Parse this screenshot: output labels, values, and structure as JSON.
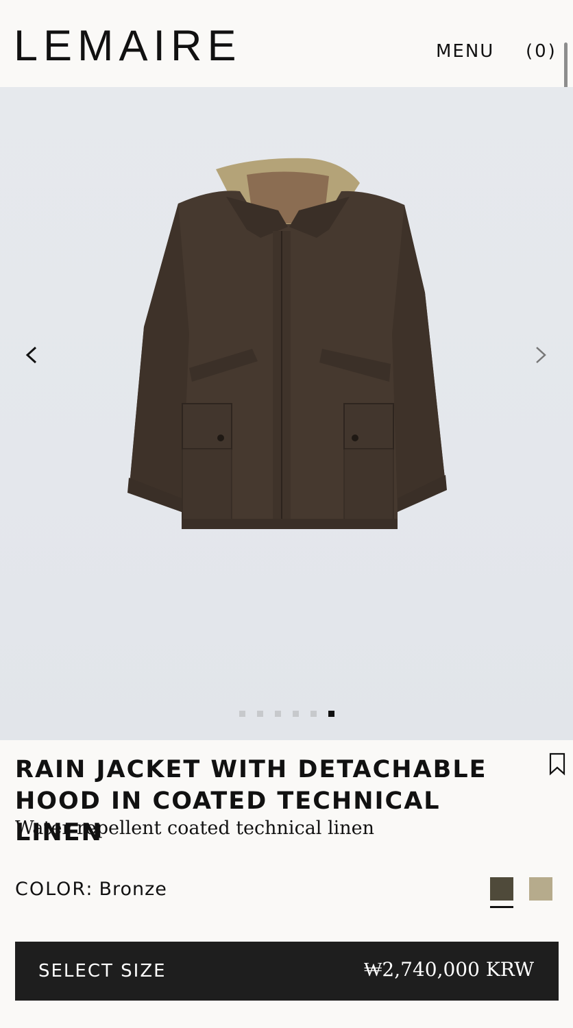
{
  "header": {
    "logo": "LEMAIRE",
    "menu_label": "MENU",
    "bag_label": "(0)"
  },
  "gallery": {
    "image_alt": "Rain jacket with detachable hood in coated technical linen",
    "slide_count": 6,
    "active_slide": 6
  },
  "product": {
    "title": "RAIN JACKET WITH DETACHABLE HOOD IN COATED TECHNICAL LINEN",
    "subtitle": "Water repellent coated technical linen",
    "color_label": "COLOR:",
    "color_value": "Bronze",
    "swatches": [
      {
        "name": "Bronze",
        "hex": "#4f4a3a",
        "selected": true
      },
      {
        "name": "Sand",
        "hex": "#b6ab8c",
        "selected": false
      }
    ]
  },
  "cta": {
    "label": "SELECT SIZE",
    "price": "₩2,740,000 KRW"
  },
  "colors": {
    "background": "#faf9f7",
    "gallery_bg": "#e5e8ec",
    "button_bg": "#1e1e1e",
    "jacket": "#46392f",
    "hood": "#b4a378"
  }
}
